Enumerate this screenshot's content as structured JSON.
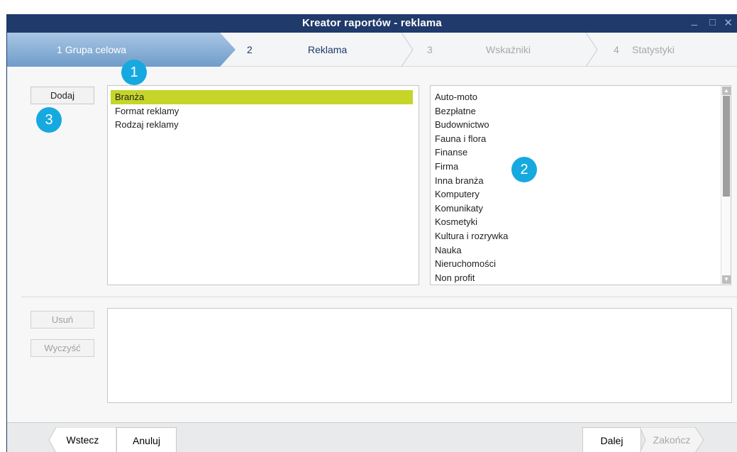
{
  "window": {
    "title": "Kreator raportów - reklama",
    "controls": {
      "minimize": "_",
      "maximize": "□",
      "close": "✕"
    }
  },
  "steps": [
    {
      "number": "1",
      "label": "Grupa celowa",
      "state": "active"
    },
    {
      "number": "2",
      "label": "Reklama",
      "state": "current"
    },
    {
      "number": "3",
      "label": "Wskaźniki",
      "state": "disabled"
    },
    {
      "number": "4",
      "label": "Statystyki",
      "state": "disabled"
    }
  ],
  "buttons": {
    "add": "Dodaj",
    "remove": "Usuń",
    "clear": "Wyczyść"
  },
  "categories": {
    "items": [
      "Branża",
      "Format reklamy",
      "Rodzaj reklamy"
    ],
    "selected": "Branża"
  },
  "values": {
    "items": [
      "Auto-moto",
      "Bezpłatne",
      "Budownictwo",
      "Fauna i flora",
      "Finanse",
      "Firma",
      "Inna branża",
      "Komputery",
      "Komunikaty",
      "Kosmetyki",
      "Kultura i rozrywka",
      "Nauka",
      "Nieruchomości",
      "Non profit"
    ]
  },
  "callouts": {
    "one": "1",
    "two": "2",
    "three": "3"
  },
  "footer": {
    "back": "Wstecz",
    "cancel": "Anuluj",
    "next": "Dalej",
    "finish": "Zakończ"
  },
  "colors": {
    "titlebar": "#1f3a6b",
    "active_step": "#7fa7cf",
    "selection": "#c5d52a",
    "callout": "#16a9e0"
  }
}
